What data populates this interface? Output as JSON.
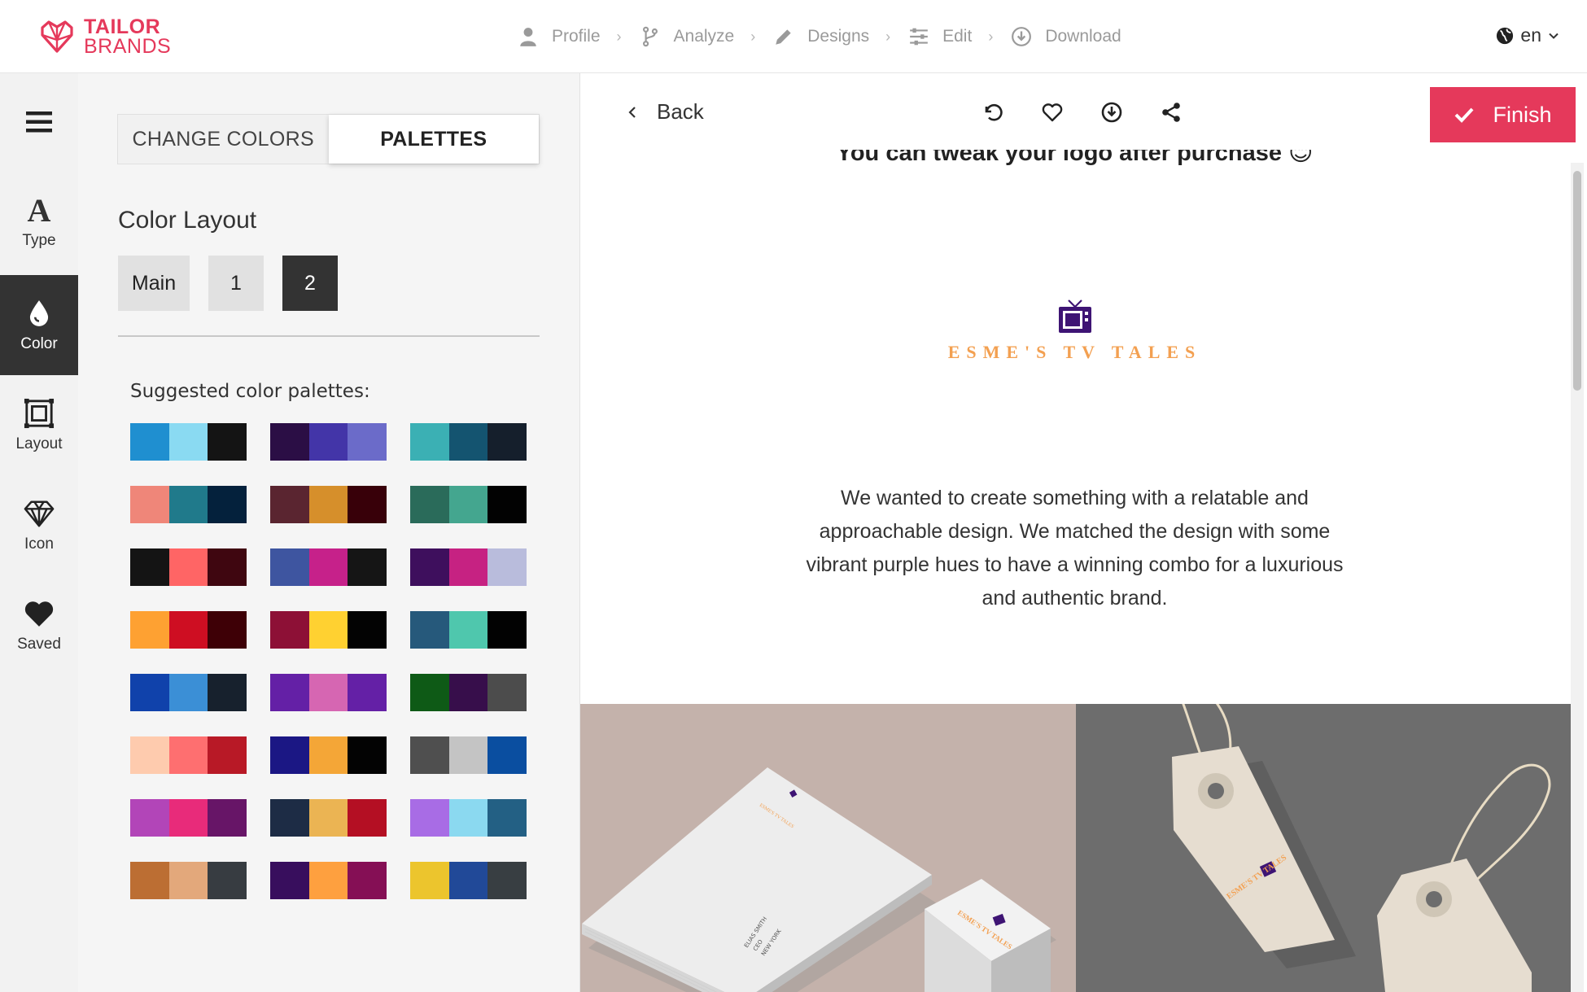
{
  "brand": {
    "line1": "TAILOR",
    "line2": "BRANDS",
    "color": "#e5395b"
  },
  "steps": [
    {
      "label": "Profile",
      "icon": "user-icon"
    },
    {
      "label": "Analyze",
      "icon": "branch-icon"
    },
    {
      "label": "Designs",
      "icon": "pencil-icon"
    },
    {
      "label": "Edit",
      "icon": "sliders-icon"
    },
    {
      "label": "Download",
      "icon": "download-icon"
    }
  ],
  "language": "en",
  "rail": [
    {
      "label": "Type",
      "icon": "type-icon"
    },
    {
      "label": "Color",
      "icon": "droplet-icon",
      "active": true
    },
    {
      "label": "Layout",
      "icon": "layout-icon"
    },
    {
      "label": "Icon",
      "icon": "diamond-icon"
    },
    {
      "label": "Saved",
      "icon": "heart-icon"
    }
  ],
  "panel": {
    "tabs": [
      "CHANGE COLORS",
      "PALETTES"
    ],
    "active_tab": "PALETTES",
    "section_title": "Color Layout",
    "layout_options": [
      "Main",
      "1",
      "2"
    ],
    "active_layout": "2",
    "suggested_label": "Suggested color palettes:",
    "palettes": [
      [
        "#1f8fd0",
        "#8adaf2",
        "#141414"
      ],
      [
        "#2b0e45",
        "#4335a8",
        "#6b6bc9"
      ],
      [
        "#3bb0b4",
        "#145470",
        "#151f2c"
      ],
      [
        "#ef8679",
        "#207a8b",
        "#04213c"
      ],
      [
        "#5a2530",
        "#d68f2b",
        "#380009"
      ],
      [
        "#2a6b5a",
        "#44a68f",
        "#020202"
      ],
      [
        "#141414",
        "#ff6565",
        "#3f0610"
      ],
      [
        "#3e55a0",
        "#c6218a",
        "#151515"
      ],
      [
        "#3e0f5d",
        "#c62282",
        "#b9bcdc"
      ],
      [
        "#fea132",
        "#ce0e22",
        "#3e0006"
      ],
      [
        "#8d1036",
        "#ffd131",
        "#030303"
      ],
      [
        "#26597b",
        "#4fc7ad",
        "#020202"
      ],
      [
        "#1042ab",
        "#3b8fd6",
        "#17212d"
      ],
      [
        "#6420a6",
        "#d666b2",
        "#6420a6"
      ],
      [
        "#0e5a16",
        "#370e4b",
        "#4c4c4c"
      ],
      [
        "#fecbae",
        "#fe6f70",
        "#b81926"
      ],
      [
        "#1b1784",
        "#f4a637",
        "#030303"
      ],
      [
        "#4f4f4f",
        "#c4c4c4",
        "#0a4ea0"
      ],
      [
        "#b245b8",
        "#e82b7a",
        "#671567"
      ],
      [
        "#1d2c45",
        "#ebb453",
        "#b40f23"
      ],
      [
        "#a86ce5",
        "#8bd9f0",
        "#236084"
      ],
      [
        "#bc6e33",
        "#e3a87b",
        "#373c41"
      ],
      [
        "#380e5d",
        "#fea03f",
        "#850f55"
      ],
      [
        "#ecc52d",
        "#214998",
        "#383e42"
      ]
    ]
  },
  "preview": {
    "back_label": "Back",
    "finish_label": "Finish",
    "finish_color": "#e5395b",
    "cut_text": "You can tweak your logo after purchase 😊",
    "brand_name": "ESME'S TV TALES",
    "brand_color": "#f3a051",
    "icon_color": "#3e1474",
    "description": "We wanted to create something with a relatable and approachable design. We matched the design with some vibrant purple hues to have a winning combo for a luxurious and authentic brand.",
    "card_text": [
      "ELIAS SMITH",
      "CEO",
      "NEW YORK",
      "ESME'S TV TALES"
    ],
    "tag_text": "ESME'S TV TALES"
  }
}
